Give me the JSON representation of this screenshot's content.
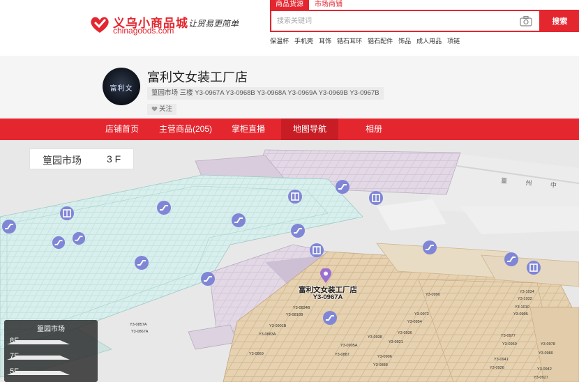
{
  "header": {
    "logo_cn": "义乌小商品城",
    "logo_en": "chinagoods.com",
    "slogan": "让贸易更简单",
    "brand_color": "#e4262f"
  },
  "search": {
    "tabs": [
      "商品货源",
      "市场商铺"
    ],
    "active_tab": 0,
    "placeholder": "搜索关键词",
    "button_label": "搜索",
    "camera_icon": "camera-icon",
    "hot_keywords": [
      "保温杯",
      "手机壳",
      "耳饰",
      "锆石耳环",
      "锆石配件",
      "饰品",
      "成人用品",
      "项链"
    ]
  },
  "shop": {
    "avatar_text": "富利文",
    "name": "富利文女装工厂店",
    "address": "篁园市场 三楼 Y3-0967A Y3-0968B Y3-0968A Y3-0969A Y3-0969B Y3-0967B",
    "follow_label": "关注",
    "heart_icon": "heart-icon"
  },
  "nav": {
    "items": [
      "店铺首页",
      "主营商品(205)",
      "掌柜直播",
      "地图导航",
      "相册"
    ],
    "active_index": 3
  },
  "map": {
    "market_name": "篁园市场",
    "floor": "3 F",
    "highlight_shop_name": "富利文女装工厂店",
    "highlight_shop_code": "Y3-0967A",
    "road_label": "篁 州 中",
    "floor_panel_title": "篁园市场",
    "floors": [
      "8F",
      "7F",
      "5F"
    ],
    "shop_codes": [
      "Y3-0869",
      "Y3-0887",
      "Y3-0888",
      "Y3-0905A",
      "Y3-0906",
      "Y3-0921",
      "Y3-0936",
      "Y3-0938",
      "Y3-0954",
      "Y3-0972",
      "Y3-0977",
      "Y3-0959",
      "Y3-0941",
      "Y3-0926",
      "Y3-0978",
      "Y3-0980",
      "Y3-0942",
      "Y3-0927",
      "Y3-0901B",
      "Y3-0883A",
      "Y3-0834B",
      "Y3-0818B",
      "Y3-0857A",
      "Y3-0867A",
      "Y3-0990",
      "Y3-1010",
      "Y3-0995",
      "Y3-1034",
      "Y3-1032"
    ]
  }
}
